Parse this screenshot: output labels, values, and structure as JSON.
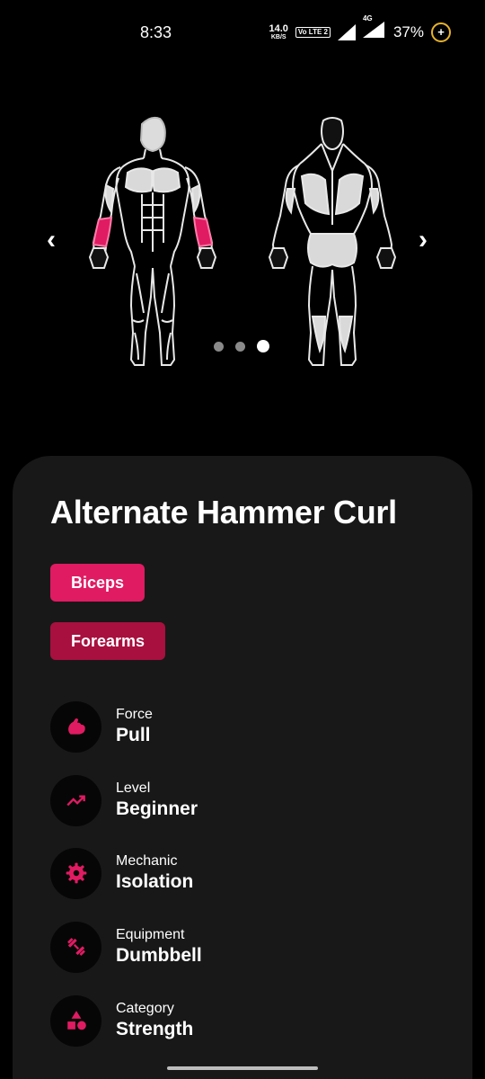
{
  "status_bar": {
    "time": "8:33",
    "net_speed_value": "14.0",
    "net_speed_unit": "KB/S",
    "volte": "Vo LTE 2",
    "network": "4G",
    "battery": "37%",
    "battery_symbol": "+"
  },
  "diagram": {
    "prev_arrow": "‹",
    "next_arrow": "›",
    "page_count": 3,
    "active_page": 3,
    "highlight_color": "#e01b62",
    "icons": [
      "muscle-front-view",
      "muscle-back-view"
    ]
  },
  "exercise": {
    "title": "Alternate Hammer Curl",
    "primary_muscle": "Biceps",
    "secondary_muscle": "Forearms",
    "attributes": [
      {
        "label": "Force",
        "value": "Pull",
        "icon": "flexed-arm-icon"
      },
      {
        "label": "Level",
        "value": "Beginner",
        "icon": "trending-up-icon"
      },
      {
        "label": "Mechanic",
        "value": "Isolation",
        "icon": "gear-icon"
      },
      {
        "label": "Equipment",
        "value": "Dumbbell",
        "icon": "dumbbell-icon"
      },
      {
        "label": "Category",
        "value": "Strength",
        "icon": "shapes-icon"
      }
    ]
  },
  "colors": {
    "accent": "#e01b62",
    "accent_dark": "#a8103f",
    "card_bg": "#181818",
    "background": "#000000"
  }
}
